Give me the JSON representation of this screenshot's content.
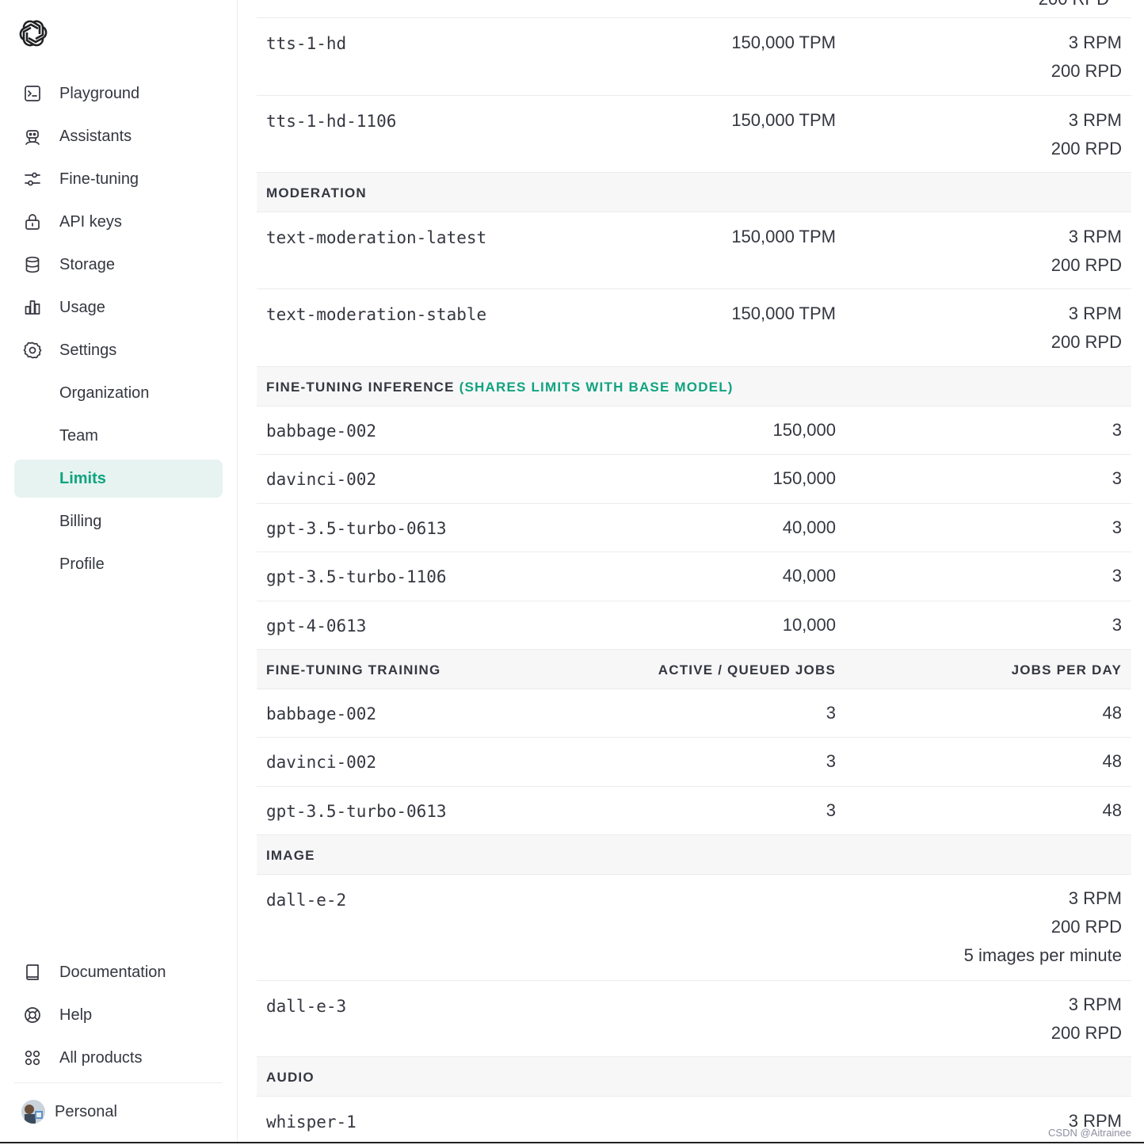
{
  "sidebar": {
    "main_items": [
      {
        "label": "Playground",
        "icon": "terminal-icon"
      },
      {
        "label": "Assistants",
        "icon": "robot-icon"
      },
      {
        "label": "Fine-tuning",
        "icon": "sliders-icon"
      },
      {
        "label": "API keys",
        "icon": "lock-icon"
      },
      {
        "label": "Storage",
        "icon": "database-icon"
      },
      {
        "label": "Usage",
        "icon": "bar-chart-icon"
      },
      {
        "label": "Settings",
        "icon": "gear-icon"
      },
      {
        "label": "Organization"
      },
      {
        "label": "Team"
      },
      {
        "label": "Limits",
        "active": true
      },
      {
        "label": "Billing"
      },
      {
        "label": "Profile"
      }
    ],
    "bottom_items": [
      {
        "label": "Documentation",
        "icon": "book-icon"
      },
      {
        "label": "Help",
        "icon": "lifebuoy-icon"
      },
      {
        "label": "All products",
        "icon": "grid-icon"
      }
    ],
    "profile_label": "Personal"
  },
  "colors": {
    "accent": "#10a37f",
    "section_bg": "#f7f7f8",
    "active_bg": "#e6f3f1"
  },
  "table": {
    "top_partial": "200 RPD",
    "tts": [
      {
        "model": "tts-1-hd",
        "tpm": "150,000 TPM",
        "rpm": "3 RPM",
        "rpd": "200 RPD"
      },
      {
        "model": "tts-1-hd-1106",
        "tpm": "150,000 TPM",
        "rpm": "3 RPM",
        "rpd": "200 RPD"
      }
    ],
    "moderation": {
      "title": "MODERATION",
      "rows": [
        {
          "model": "text-moderation-latest",
          "tpm": "150,000 TPM",
          "rpm": "3 RPM",
          "rpd": "200 RPD"
        },
        {
          "model": "text-moderation-stable",
          "tpm": "150,000 TPM",
          "rpm": "3 RPM",
          "rpd": "200 RPD"
        }
      ]
    },
    "ft_inference": {
      "title": "FINE-TUNING INFERENCE",
      "note": "(SHARES LIMITS WITH BASE MODEL)",
      "rows": [
        {
          "model": "babbage-002",
          "mid": "150,000",
          "right": "3"
        },
        {
          "model": "davinci-002",
          "mid": "150,000",
          "right": "3"
        },
        {
          "model": "gpt-3.5-turbo-0613",
          "mid": "40,000",
          "right": "3"
        },
        {
          "model": "gpt-3.5-turbo-1106",
          "mid": "40,000",
          "right": "3"
        },
        {
          "model": "gpt-4-0613",
          "mid": "10,000",
          "right": "3"
        }
      ]
    },
    "ft_training": {
      "title": "FINE-TUNING TRAINING",
      "col_mid": "ACTIVE / QUEUED JOBS",
      "col_right": "JOBS PER DAY",
      "rows": [
        {
          "model": "babbage-002",
          "mid": "3",
          "right": "48"
        },
        {
          "model": "davinci-002",
          "mid": "3",
          "right": "48"
        },
        {
          "model": "gpt-3.5-turbo-0613",
          "mid": "3",
          "right": "48"
        }
      ]
    },
    "image": {
      "title": "IMAGE",
      "rows": [
        {
          "model": "dall-e-2",
          "rpm": "3 RPM",
          "rpd": "200 RPD",
          "extra": "5 images per minute"
        },
        {
          "model": "dall-e-3",
          "rpm": "3 RPM",
          "rpd": "200 RPD"
        }
      ]
    },
    "audio": {
      "title": "AUDIO",
      "rows": [
        {
          "model": "whisper-1",
          "rpm": "3 RPM"
        }
      ]
    }
  },
  "watermark": "CSDN @Aitrainee"
}
